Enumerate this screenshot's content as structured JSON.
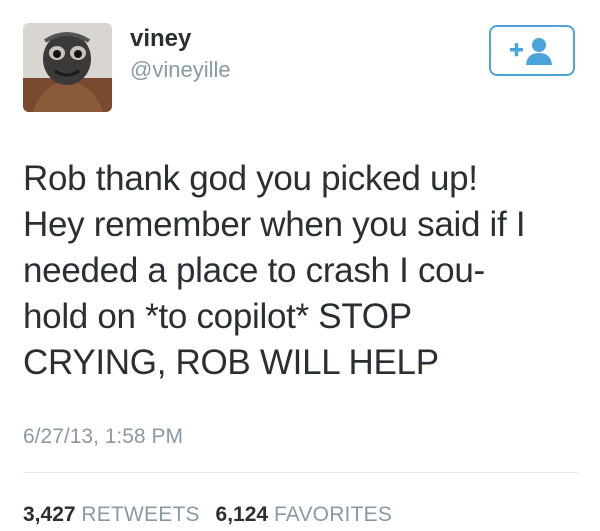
{
  "user": {
    "name": "viney",
    "handle": "@vineyille"
  },
  "tweet": {
    "text": "Rob thank god you picked up!\nHey remember when you said if I\nneeded a place to crash I cou-\nhold on *to copilot* STOP\nCRYING, ROB WILL HELP",
    "timestamp": "6/27/13, 1:58 PM"
  },
  "stats": {
    "retweets_count": "3,427",
    "retweets_label": "RETWEETS",
    "favorites_count": "6,124",
    "favorites_label": "FAVORITES"
  },
  "colors": {
    "accent": "#4ba3dc",
    "text": "#292f33",
    "muted": "#8899a6"
  },
  "icons": {
    "follow": "add-user-icon"
  }
}
